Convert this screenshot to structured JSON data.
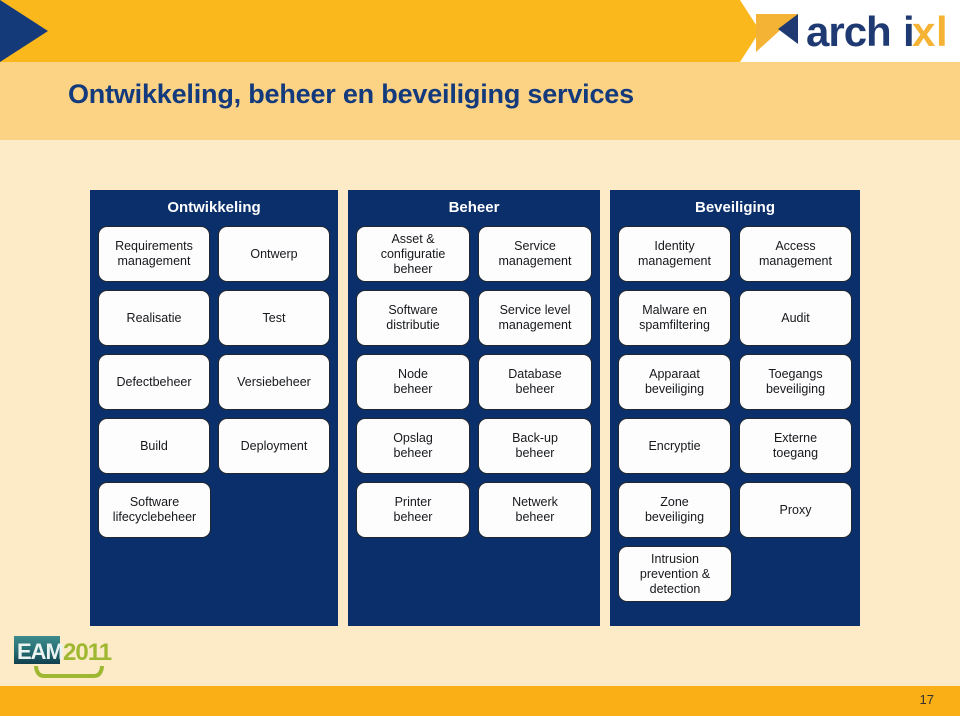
{
  "header": {
    "logo_text": "archixl",
    "logo_icon": "archixl-triangle-mark"
  },
  "title": "Ontwikkeling, beheer en beveiliging services",
  "columns": [
    {
      "header": "Ontwikkeling",
      "rows": [
        [
          "Requirements\nmanagement",
          "Ontwerp"
        ],
        [
          "Realisatie",
          "Test"
        ],
        [
          "Defectbeheer",
          "Versiebeheer"
        ],
        [
          "Build",
          "Deployment"
        ],
        [
          "Software\nlifecyclebeheer",
          ""
        ]
      ]
    },
    {
      "header": "Beheer",
      "rows": [
        [
          "Asset &\nconfiguratie\nbeheer",
          "Service\nmanagement"
        ],
        [
          "Software\ndistributie",
          "Service level\nmanagement"
        ],
        [
          "Node\nbeheer",
          "Database\nbeheer"
        ],
        [
          "Opslag\nbeheer",
          "Back-up\nbeheer"
        ],
        [
          "Printer\nbeheer",
          "Netwerk\nbeheer"
        ]
      ]
    },
    {
      "header": "Beveiliging",
      "rows": [
        [
          "Identity\nmanagement",
          "Access\nmanagement"
        ],
        [
          "Malware en\nspamfiltering",
          "Audit"
        ],
        [
          "Apparaat\nbeveiliging",
          "Toegangs\nbeveiliging"
        ],
        [
          "Encryptie",
          "Externe\ntoegang"
        ],
        [
          "Zone\nbeveiliging",
          "Proxy"
        ],
        [
          "Intrusion\nprevention &\ndetection",
          ""
        ]
      ]
    }
  ],
  "footer": {
    "conference_logo_primary": "EAM",
    "conference_logo_year": "2011",
    "page_number": "17"
  },
  "colors": {
    "banner_orange": "#fab81d",
    "title_band": "#fcd384",
    "page_background": "#fdebc8",
    "column_navy": "#0b2f6b",
    "footer_orange": "#fbaf17",
    "title_text": "#123a7c"
  }
}
